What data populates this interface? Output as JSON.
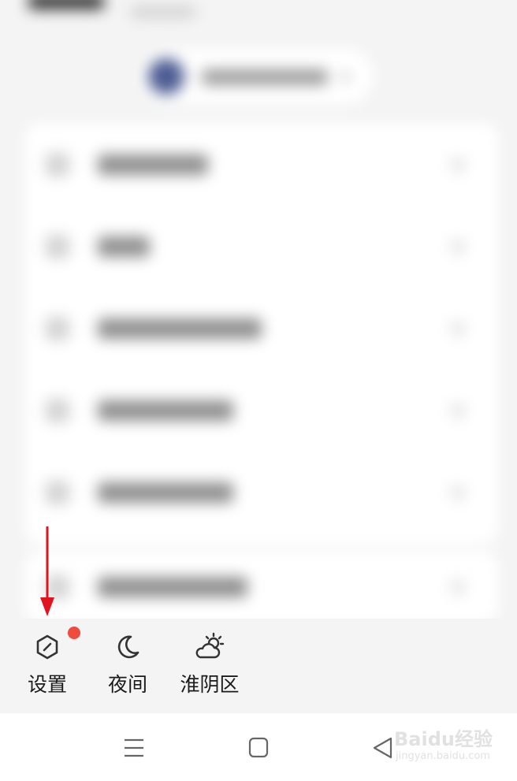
{
  "quick_actions": [
    {
      "label": "设置",
      "icon": "settings-hexagon-icon",
      "has_badge": true
    },
    {
      "label": "夜间",
      "icon": "moon-icon"
    },
    {
      "label": "淮阴区",
      "icon": "cloudy-sun-weather-icon"
    }
  ],
  "system_nav": {
    "buttons": [
      "menu-icon",
      "home-square-icon",
      "back-triangle-icon"
    ]
  },
  "watermark": {
    "main": "Baidu经验",
    "sub": "jingyan.baidu.com"
  },
  "colors": {
    "badge": "#f04b3c",
    "annotation_arrow": "#e0141e",
    "avatar": "#4d5c92"
  }
}
